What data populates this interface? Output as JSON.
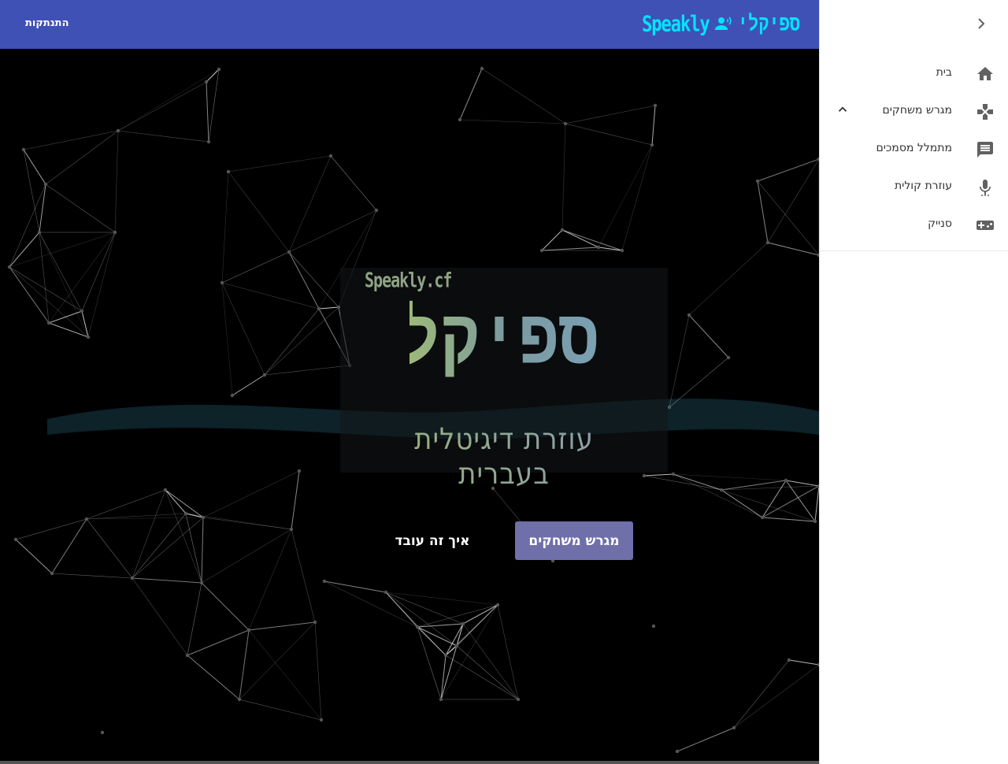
{
  "header": {
    "logout_label": "התנתקות",
    "logo_text_en": "Speakly",
    "logo_text_he": "ספיקלי",
    "logo_icon": "record-voice-icon",
    "bar_color": "#3f51b5",
    "accent_color": "#00e5ff"
  },
  "hero": {
    "domain": "Speakly.cf",
    "title": "ספיקלי",
    "subtitle": "עוזרת דיגיטלית בעברית",
    "primary_button": "מגרש משחקים",
    "secondary_button": "איך זה עובד",
    "primary_button_color": "#6f6fa9"
  },
  "drawer": {
    "toggle_icon": "chevron-right-icon",
    "items": [
      {
        "label": "בית",
        "icon": "home-icon"
      },
      {
        "label": "מגרש משחקים",
        "icon": "gamepad-icon",
        "expand_icon": "chevron-up-icon"
      },
      {
        "label": "מתמלל מסמכים",
        "icon": "message-icon"
      },
      {
        "label": "עוזרת קולית",
        "icon": "microphone-icon"
      },
      {
        "label": "סנייק",
        "icon": "videogame-icon"
      }
    ]
  }
}
